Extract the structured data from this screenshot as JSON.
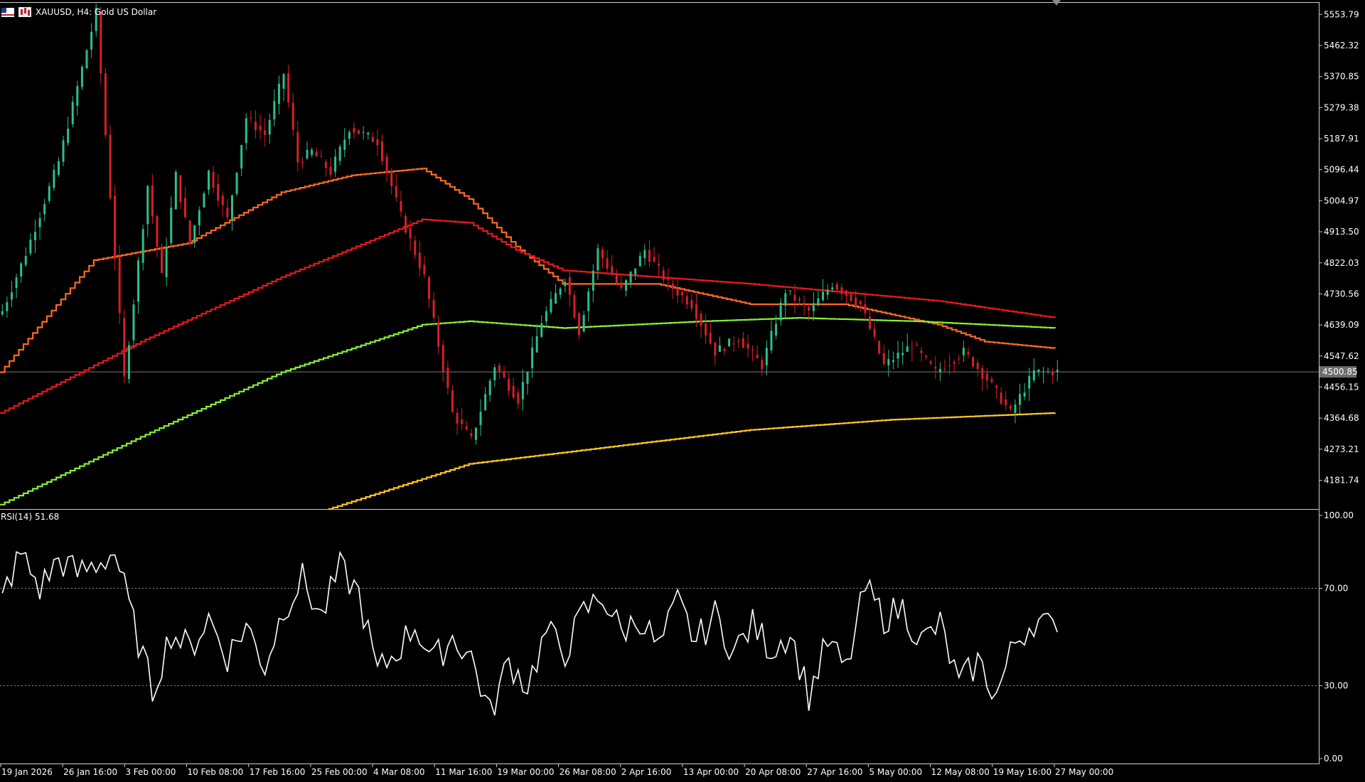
{
  "window": {
    "title": "XAUUSD, H4:  Gold US Dollar"
  },
  "colors": {
    "background": "#000000",
    "frame": "#cfcfcf",
    "bull": "#2bbf8e",
    "bear": "#d62028",
    "price_line": "#7a7a7a",
    "ma_fast": "#ff6a20",
    "ma_slow": "#e8191c",
    "ma_green": "#88f032",
    "ma_yellow": "#ffc81e",
    "rsi": "#ffffff"
  },
  "icons": [
    "flag-icon",
    "candlestick-chart-icon",
    "scroll-marker-icon"
  ],
  "chart_data": {
    "type": "line",
    "symbol": "XAUUSD",
    "timeframe": "H4",
    "description": "Gold US Dollar",
    "x_labels": [
      "19 Jan 2026",
      "26 Jan 16:00",
      "3 Feb 00:00",
      "10 Feb 08:00",
      "17 Feb 16:00",
      "25 Feb 00:00",
      "4 Mar 08:00",
      "11 Mar 16:00",
      "19 Mar 00:00",
      "26 Mar 08:00",
      "2 Apr 16:00",
      "13 Apr 00:00",
      "20 Apr 08:00",
      "27 Apr 16:00",
      "5 May 00:00",
      "12 May 08:00",
      "19 May 16:00",
      "27 May 00:00"
    ],
    "price_axis": {
      "ylim": [
        4097,
        5590
      ],
      "ticks": [
        "5553.79",
        "5462.32",
        "5370.85",
        "5279.38",
        "5187.91",
        "5096.44",
        "5004.97",
        "4913.50",
        "4822.03",
        "4730.56",
        "4639.09",
        "4547.62",
        "4456.15",
        "4364.68",
        "4273.21",
        "4181.74"
      ],
      "current_price": "4500.85"
    },
    "price_series": {
      "name": "XAUUSD",
      "x": [
        0,
        5,
        12,
        20,
        26,
        31,
        34,
        37,
        40,
        44,
        48,
        52,
        56,
        60,
        63,
        66,
        70,
        74,
        80,
        85,
        90,
        96,
        100,
        105,
        110,
        115,
        120,
        123,
        127,
        132,
        137,
        142,
        147,
        152,
        157,
        162,
        167,
        172,
        177,
        183,
        188,
        194,
        199,
        205,
        210,
        215,
        220,
        225
      ],
      "close": [
        4680,
        4850,
        5120,
        5560,
        4480,
        5050,
        4780,
        5080,
        4880,
        5090,
        4950,
        5250,
        5200,
        5380,
        5120,
        5150,
        5090,
        5220,
        5180,
        4960,
        4780,
        4380,
        4300,
        4520,
        4420,
        4650,
        4780,
        4620,
        4860,
        4740,
        4860,
        4760,
        4700,
        4560,
        4600,
        4520,
        4740,
        4680,
        4760,
        4700,
        4520,
        4580,
        4500,
        4560,
        4480,
        4380,
        4500,
        4501
      ]
    },
    "series": [
      {
        "name": "",
        "color": "#ff6a20",
        "x": [
          0,
          20,
          40,
          60,
          75,
          90,
          100,
          110,
          120,
          140,
          160,
          180,
          200,
          210,
          225
        ],
        "y": [
          4500,
          4830,
          4880,
          5030,
          5080,
          5100,
          5010,
          4870,
          4760,
          4760,
          4700,
          4700,
          4640,
          4590,
          4570
        ]
      },
      {
        "name": "",
        "color": "#e8191c",
        "x": [
          0,
          30,
          60,
          90,
          100,
          110,
          120,
          160,
          200,
          225
        ],
        "y": [
          4380,
          4590,
          4780,
          4950,
          4940,
          4860,
          4800,
          4760,
          4710,
          4660
        ]
      },
      {
        "name": "",
        "color": "#88f032",
        "x": [
          0,
          30,
          60,
          90,
          100,
          120,
          150,
          170,
          195,
          225
        ],
        "y": [
          4110,
          4310,
          4500,
          4640,
          4650,
          4630,
          4650,
          4660,
          4650,
          4630
        ]
      },
      {
        "name": "",
        "color": "#ffc81e",
        "x": [
          70,
          100,
          130,
          160,
          190,
          225
        ],
        "y": [
          4097,
          4230,
          4280,
          4330,
          4360,
          4380
        ]
      }
    ]
  },
  "rsi": {
    "label": "RSI(14) 51.68",
    "name": "RSI(14)",
    "value": "51.68",
    "ylim": [
      0,
      100
    ],
    "ticks": [
      "100.00",
      "70.00",
      "30.00",
      "0.00"
    ],
    "levels": [
      70,
      30
    ],
    "x": [
      0,
      4,
      8,
      12,
      16,
      20,
      24,
      28,
      32,
      36,
      40,
      44,
      48,
      52,
      56,
      60,
      64,
      68,
      72,
      76,
      80,
      84,
      88,
      92,
      96,
      100,
      104,
      108,
      112,
      116,
      120,
      124,
      128,
      132,
      136,
      140,
      144,
      148,
      152,
      156,
      160,
      164,
      168,
      172,
      176,
      180,
      184,
      188,
      192,
      196,
      200,
      204,
      208,
      212,
      216,
      220,
      225
    ],
    "values": [
      68,
      84,
      70,
      82,
      76,
      80,
      85,
      55,
      28,
      52,
      45,
      58,
      42,
      55,
      38,
      62,
      74,
      58,
      78,
      68,
      35,
      44,
      55,
      40,
      50,
      42,
      18,
      40,
      30,
      52,
      44,
      60,
      67,
      52,
      58,
      45,
      64,
      48,
      59,
      44,
      55,
      45,
      52,
      26,
      48,
      36,
      70,
      58,
      62,
      48,
      55,
      30,
      40,
      26,
      48,
      57,
      52
    ]
  }
}
